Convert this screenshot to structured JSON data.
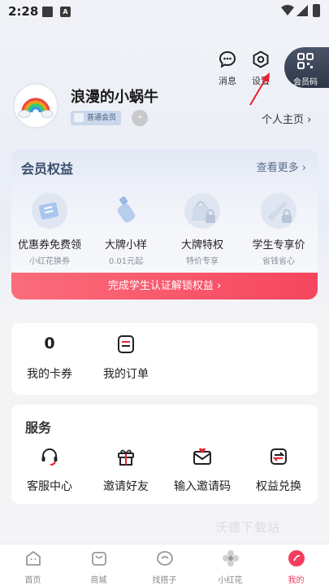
{
  "status_bar": {
    "time": "2:28",
    "notif_icon_letter": "A"
  },
  "header": {
    "messages_label": "消息",
    "settings_label": "设置",
    "member_code_label": "会员码"
  },
  "profile": {
    "username": "浪漫的小蜗牛",
    "badge": "普通会员",
    "homepage_link": "个人主页 ›"
  },
  "benefits": {
    "title": "会员权益",
    "more_link": "查看更多 ›",
    "items": [
      {
        "name": "优惠券免费领",
        "sub": "小红花换券",
        "icon": "coupon-icon"
      },
      {
        "name": "大牌小样",
        "sub": "0.01元起",
        "icon": "sample-bottle-icon"
      },
      {
        "name": "大牌特权",
        "sub": "特价专享",
        "icon": "bag-locked-icon"
      },
      {
        "name": "学生专享价",
        "sub": "省钱省心",
        "icon": "student-locked-icon"
      }
    ],
    "cta": "完成学生认证解锁权益 ›"
  },
  "orders": {
    "coupons_count": "0",
    "coupons_label": "我的卡券",
    "orders_label": "我的订单"
  },
  "services": {
    "title": "服务",
    "items": [
      {
        "label": "客服中心",
        "icon": "headset-icon"
      },
      {
        "label": "邀请好友",
        "icon": "gift-icon"
      },
      {
        "label": "输入邀请码",
        "icon": "envelope-icon"
      },
      {
        "label": "权益兑换",
        "icon": "exchange-icon"
      }
    ]
  },
  "watermark": "沃德下载站",
  "tabs": [
    {
      "label": "首页"
    },
    {
      "label": "商城"
    },
    {
      "label": "找搭子"
    },
    {
      "label": "小红花"
    },
    {
      "label": "我的",
      "active": true
    }
  ],
  "colors": {
    "accent": "#f33c5e",
    "member_blue": "#3a4e6e",
    "cta_red": "#f6465f"
  }
}
